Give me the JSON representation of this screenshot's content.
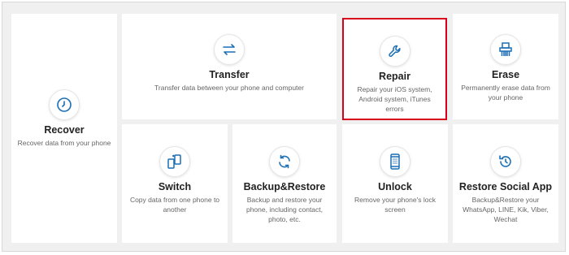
{
  "cards": {
    "recover": {
      "title": "Recover",
      "desc": "Recover data from your phone"
    },
    "transfer": {
      "title": "Transfer",
      "desc": "Transfer data between your phone and computer"
    },
    "repair": {
      "title": "Repair",
      "desc": "Repair your iOS system, Android system, iTunes errors"
    },
    "erase": {
      "title": "Erase",
      "desc": "Permanently erase data from your phone"
    },
    "switch": {
      "title": "Switch",
      "desc": "Copy data from one phone to another"
    },
    "backup": {
      "title": "Backup&Restore",
      "desc": "Backup and restore your phone, including contact, photo, etc."
    },
    "unlock": {
      "title": "Unlock",
      "desc": "Remove your phone's lock screen"
    },
    "social": {
      "title": "Restore Social App",
      "desc": "Backup&Restore your WhatsApp, LINE, Kik, Viber, Wechat"
    }
  },
  "colors": {
    "accent": "#1a6fb5",
    "selected_border": "#d9001b"
  },
  "icons": {
    "recover": "clock-icon",
    "transfer": "transfer-arrows-icon",
    "repair": "wrench-icon",
    "erase": "shredder-icon",
    "switch": "phone-switch-icon",
    "backup": "sync-icon",
    "unlock": "phone-keypad-icon",
    "social": "restore-arrow-icon"
  }
}
